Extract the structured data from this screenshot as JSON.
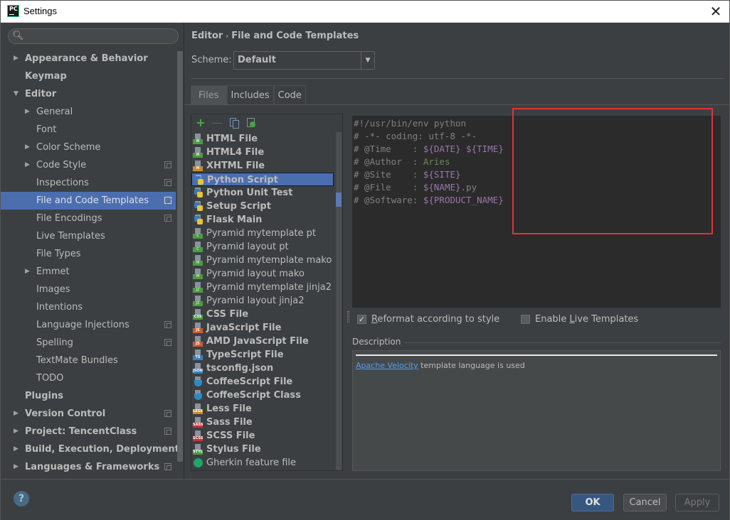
{
  "window": {
    "title": "Settings",
    "app_icon": "PC"
  },
  "sidebar": {
    "search_placeholder": "",
    "items": [
      {
        "label": "Appearance & Behavior",
        "level": 0,
        "bold": true,
        "arrow": "collapsed",
        "scope": false
      },
      {
        "label": "Keymap",
        "level": 0,
        "bold": true,
        "arrow": "none",
        "scope": false
      },
      {
        "label": "Editor",
        "level": 0,
        "bold": true,
        "arrow": "expanded",
        "scope": false
      },
      {
        "label": "General",
        "level": 1,
        "bold": false,
        "arrow": "collapsed",
        "scope": false
      },
      {
        "label": "Font",
        "level": 1,
        "bold": false,
        "arrow": "none",
        "scope": false
      },
      {
        "label": "Color Scheme",
        "level": 1,
        "bold": false,
        "arrow": "collapsed",
        "scope": false
      },
      {
        "label": "Code Style",
        "level": 1,
        "bold": false,
        "arrow": "collapsed",
        "scope": true
      },
      {
        "label": "Inspections",
        "level": 1,
        "bold": false,
        "arrow": "none",
        "scope": true
      },
      {
        "label": "File and Code Templates",
        "level": 1,
        "bold": false,
        "arrow": "none",
        "scope": true,
        "selected": true
      },
      {
        "label": "File Encodings",
        "level": 1,
        "bold": false,
        "arrow": "none",
        "scope": true
      },
      {
        "label": "Live Templates",
        "level": 1,
        "bold": false,
        "arrow": "none",
        "scope": false
      },
      {
        "label": "File Types",
        "level": 1,
        "bold": false,
        "arrow": "none",
        "scope": false
      },
      {
        "label": "Emmet",
        "level": 1,
        "bold": false,
        "arrow": "collapsed",
        "scope": false
      },
      {
        "label": "Images",
        "level": 1,
        "bold": false,
        "arrow": "none",
        "scope": false
      },
      {
        "label": "Intentions",
        "level": 1,
        "bold": false,
        "arrow": "none",
        "scope": false
      },
      {
        "label": "Language Injections",
        "level": 1,
        "bold": false,
        "arrow": "none",
        "scope": true
      },
      {
        "label": "Spelling",
        "level": 1,
        "bold": false,
        "arrow": "none",
        "scope": true
      },
      {
        "label": "TextMate Bundles",
        "level": 1,
        "bold": false,
        "arrow": "none",
        "scope": false
      },
      {
        "label": "TODO",
        "level": 1,
        "bold": false,
        "arrow": "none",
        "scope": false
      },
      {
        "label": "Plugins",
        "level": 0,
        "bold": true,
        "arrow": "none",
        "scope": false
      },
      {
        "label": "Version Control",
        "level": 0,
        "bold": true,
        "arrow": "collapsed",
        "scope": true
      },
      {
        "label": "Project: TencentClass",
        "level": 0,
        "bold": true,
        "arrow": "collapsed",
        "scope": true
      },
      {
        "label": "Build, Execution, Deployment",
        "level": 0,
        "bold": true,
        "arrow": "collapsed",
        "scope": false
      },
      {
        "label": "Languages & Frameworks",
        "level": 0,
        "bold": true,
        "arrow": "collapsed",
        "scope": true
      }
    ]
  },
  "main": {
    "breadcrumb": {
      "parent": "Editor",
      "separator": "›",
      "current": "File and Code Templates"
    },
    "scheme": {
      "label": "Scheme:",
      "value": "Default"
    },
    "tabs": [
      {
        "label": "Files",
        "active": true
      },
      {
        "label": "Includes",
        "active": false
      },
      {
        "label": "Code",
        "active": false
      }
    ],
    "toolbar": {
      "add": "+",
      "remove": "—",
      "copy_title": "Copy template",
      "reset_title": "Reset to default"
    },
    "templates": [
      {
        "label": "HTML File",
        "bold": true,
        "icon": "html",
        "badge": "H",
        "color": "#4e9a44"
      },
      {
        "label": "HTML4 File",
        "bold": true,
        "icon": "html",
        "badge": "H",
        "color": "#4e9a44"
      },
      {
        "label": "XHTML File",
        "bold": true,
        "icon": "html",
        "badge": "H",
        "color": "#c88a2e"
      },
      {
        "label": "Python Script",
        "bold": true,
        "icon": "python",
        "selected": true
      },
      {
        "label": "Python Unit Test",
        "bold": true,
        "icon": "python"
      },
      {
        "label": "Setup Script",
        "bold": true,
        "icon": "python"
      },
      {
        "label": "Flask Main",
        "bold": true,
        "icon": "python"
      },
      {
        "label": "Pyramid mytemplate pt",
        "bold": false,
        "icon": "file",
        "badge": "C",
        "color": "#4e9a44"
      },
      {
        "label": "Pyramid layout pt",
        "bold": false,
        "icon": "file",
        "badge": "C",
        "color": "#4e9a44"
      },
      {
        "label": "Pyramid mytemplate mako",
        "bold": false,
        "icon": "file",
        "badge": "M",
        "color": "#4e9a44"
      },
      {
        "label": "Pyramid layout mako",
        "bold": false,
        "icon": "file",
        "badge": "M",
        "color": "#4e9a44"
      },
      {
        "label": "Pyramid mytemplate jinja2",
        "bold": false,
        "icon": "file",
        "badge": "J2",
        "color": "#4e9a44"
      },
      {
        "label": "Pyramid layout jinja2",
        "bold": false,
        "icon": "file",
        "badge": "J2",
        "color": "#4e9a44"
      },
      {
        "label": "CSS File",
        "bold": true,
        "icon": "file",
        "badge": "CSS",
        "color": "#4e9a44"
      },
      {
        "label": "JavaScript File",
        "bold": true,
        "icon": "file",
        "badge": "JS",
        "color": "#d4592a"
      },
      {
        "label": "AMD JavaScript File",
        "bold": true,
        "icon": "file",
        "badge": "JS",
        "color": "#d4592a"
      },
      {
        "label": "TypeScript File",
        "bold": true,
        "icon": "file",
        "badge": "TS",
        "color": "#3b80b8"
      },
      {
        "label": "tsconfig.json",
        "bold": true,
        "icon": "file",
        "badge": "JSON",
        "color": "#3b80b8"
      },
      {
        "label": "CoffeeScript File",
        "bold": true,
        "icon": "coffee"
      },
      {
        "label": "CoffeeScript Class",
        "bold": true,
        "icon": "coffee"
      },
      {
        "label": "Less File",
        "bold": true,
        "icon": "file",
        "badge": "LESS",
        "color": "#c88a2e"
      },
      {
        "label": "Sass File",
        "bold": true,
        "icon": "file",
        "badge": "SASS",
        "color": "#c0333a"
      },
      {
        "label": "SCSS File",
        "bold": true,
        "icon": "file",
        "badge": "SCSS",
        "color": "#c0333a"
      },
      {
        "label": "Stylus File",
        "bold": true,
        "icon": "file",
        "badge": "STYL",
        "color": "#4e9a44"
      },
      {
        "label": "Gherkin feature file",
        "bold": false,
        "icon": "gherkin"
      }
    ],
    "code_lines": [
      [
        {
          "t": "#!/usr/bin/env python",
          "c": "comment"
        }
      ],
      [
        {
          "t": "# -*- coding: utf-8 -*-",
          "c": "comment"
        }
      ],
      [
        {
          "t": "# @Time    : ",
          "c": "comment"
        },
        {
          "t": "${DATE}",
          "c": "var"
        },
        {
          "t": " ",
          "c": "comment"
        },
        {
          "t": "${TIME}",
          "c": "var"
        }
      ],
      [
        {
          "t": "# @Author  : ",
          "c": "comment"
        },
        {
          "t": "Aries",
          "c": "plain"
        }
      ],
      [
        {
          "t": "# @Site    : ",
          "c": "comment"
        },
        {
          "t": "${SITE}",
          "c": "var"
        }
      ],
      [
        {
          "t": "# @File    : ",
          "c": "comment"
        },
        {
          "t": "${NAME}",
          "c": "var"
        },
        {
          "t": ".py",
          "c": "comment"
        }
      ],
      [
        {
          "t": "# @Software: ",
          "c": "comment"
        },
        {
          "t": "${PRODUCT_NAME}",
          "c": "var"
        }
      ]
    ],
    "options": {
      "reformat": {
        "pre": "",
        "mnemonic": "R",
        "post": "eformat according to style",
        "checked": true
      },
      "live_templates": {
        "pre": "Enable ",
        "mnemonic": "L",
        "post": "ive Templates",
        "checked": false
      }
    },
    "description": {
      "label": "Description",
      "link": "Apache Velocity",
      "text": " template language is used"
    }
  },
  "footer": {
    "help": "?",
    "ok": "OK",
    "cancel": "Cancel",
    "apply": "Apply"
  },
  "colors": {
    "accent": "#4b6eaf",
    "highlight_box": "#e0333a",
    "link": "#589df6",
    "var": "#9876aa"
  }
}
